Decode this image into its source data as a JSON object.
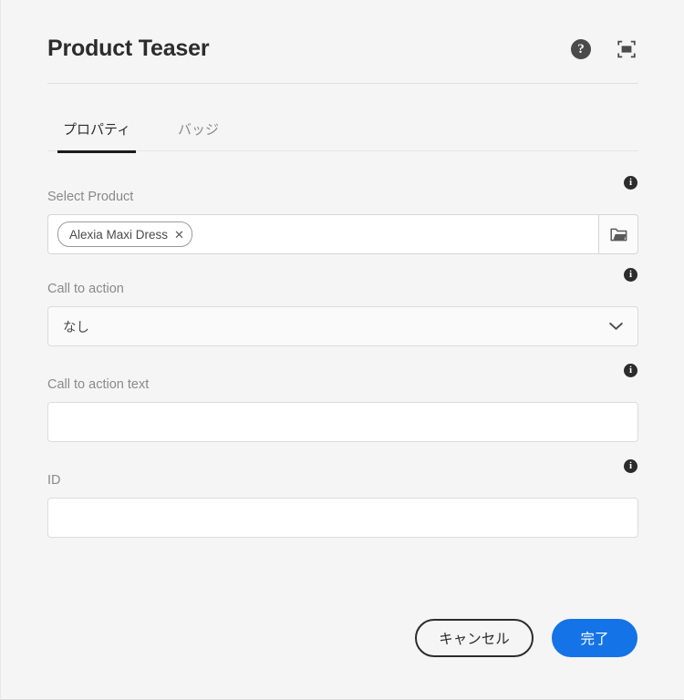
{
  "dialog": {
    "title": "Product Teaser",
    "header_icons": [
      {
        "name": "help-icon",
        "glyph": "?"
      },
      {
        "name": "fullscreen-icon",
        "glyph": "fullscreen"
      }
    ]
  },
  "tabs": [
    {
      "id": "properties",
      "label": "プロパティ",
      "active": true
    },
    {
      "id": "badge",
      "label": "バッジ",
      "active": false
    }
  ],
  "fields": {
    "select_product": {
      "label": "Select Product",
      "chip": {
        "label": "Alexia Maxi Dress",
        "remove_glyph": "✕"
      },
      "browse_icon": "folder-icon",
      "info_glyph": "i"
    },
    "call_to_action": {
      "label": "Call to action",
      "value": "なし",
      "chevron_icon": "chevron-down-icon",
      "info_glyph": "i"
    },
    "call_to_action_text": {
      "label": "Call to action text",
      "value": "",
      "placeholder": "",
      "info_glyph": "i"
    },
    "id": {
      "label": "ID",
      "value": "",
      "placeholder": "",
      "info_glyph": "i"
    }
  },
  "footer": {
    "cancel_label": "キャンセル",
    "done_label": "完了"
  },
  "colors": {
    "accent": "#1473E6",
    "background": "#F5F5F5",
    "text": "#2C2C2C",
    "label": "#8A8A8A"
  }
}
